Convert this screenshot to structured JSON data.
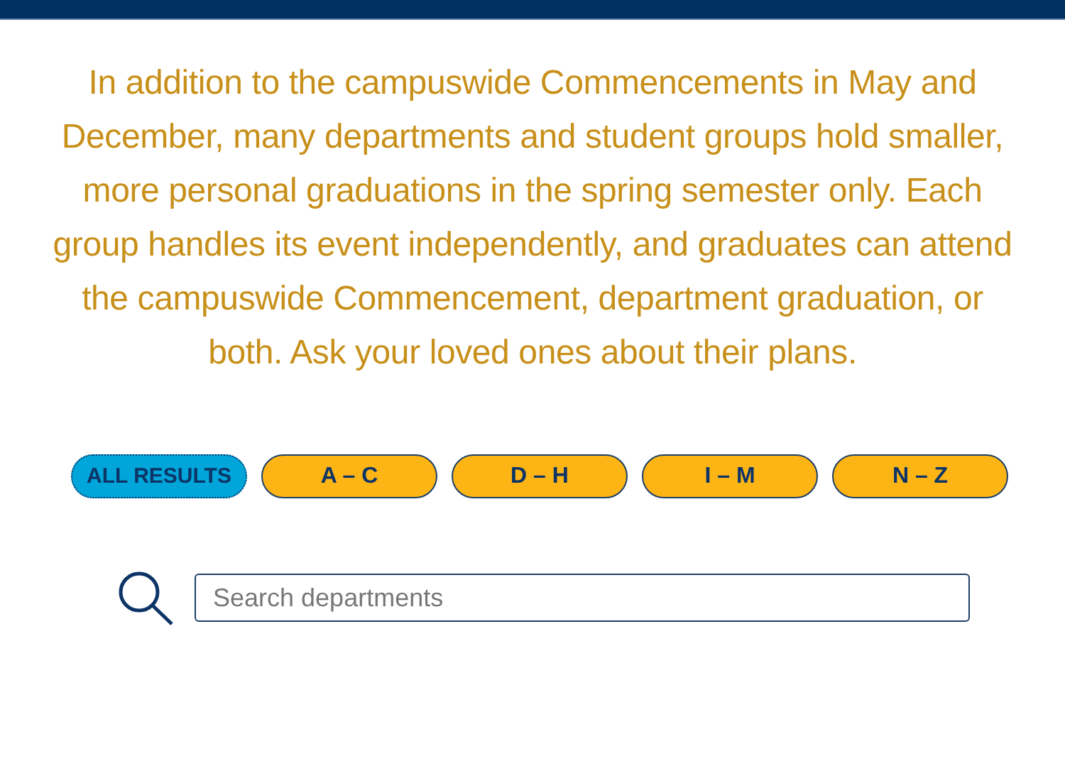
{
  "intro": "In addition to the campuswide Commencements in May and December, many departments and student groups hold smaller, more personal graduations in the spring semester only. Each group handles its event independently, and graduates can attend the campuswide Commencement, department graduation, or both. Ask your loved ones about their plans.",
  "filters": [
    {
      "label": "ALL RESULTS",
      "selected": true
    },
    {
      "label": "A – C",
      "selected": false
    },
    {
      "label": "D – H",
      "selected": false
    },
    {
      "label": "I – M",
      "selected": false
    },
    {
      "label": "N – Z",
      "selected": false
    }
  ],
  "search": {
    "placeholder": "Search departments"
  }
}
